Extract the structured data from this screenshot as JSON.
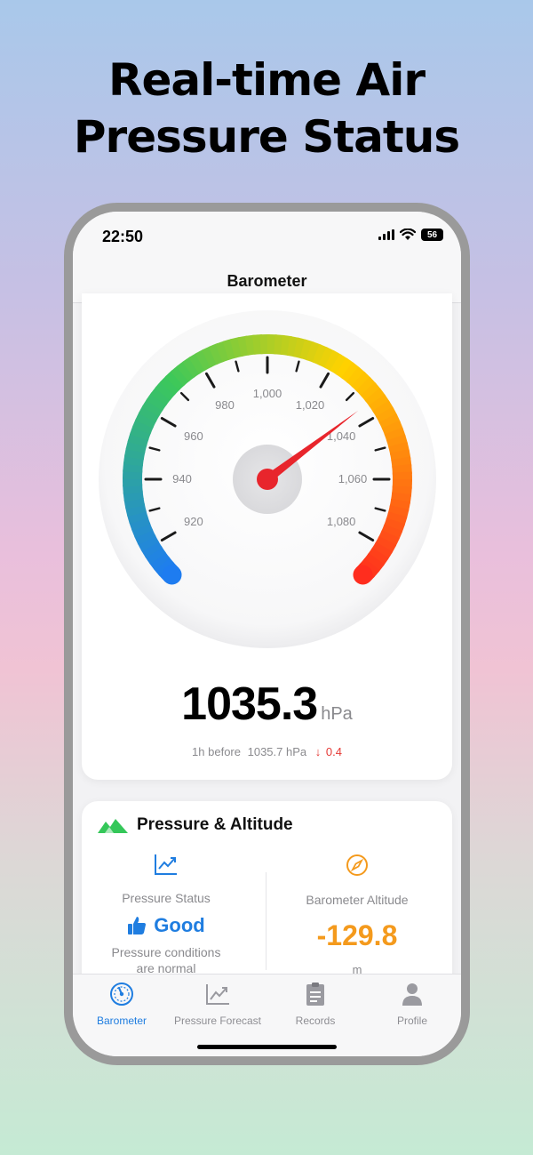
{
  "headline": {
    "line1": "Real-time Air",
    "line2": "Pressure Status"
  },
  "status_bar": {
    "time": "22:50",
    "battery": "56"
  },
  "nav": {
    "title": "Barometer"
  },
  "gauge": {
    "reading": "1035.3",
    "unit": "hPa",
    "min": 910,
    "max": 1090,
    "value": 1035.3,
    "tick_labels": [
      "920",
      "940",
      "960",
      "980",
      "1,000",
      "1,020",
      "1,040",
      "1,060",
      "1,080"
    ],
    "history_prefix": "1h before",
    "history_value": "1035.7 hPa",
    "history_change": "0.4",
    "colors": {
      "needle": "#e8252c",
      "arc_start": "#1e7cf0",
      "arc_mid": "#3cc85a",
      "arc_high": "#ffd200",
      "arc_end": "#ff2d1e"
    }
  },
  "altitude_card": {
    "title": "Pressure & Altitude",
    "header_icon": "mountain-icon",
    "left": {
      "icon": "trend-chart-icon",
      "label": "Pressure Status",
      "status_icon": "thumbs-up-icon",
      "status": "Good",
      "description_line1": "Pressure conditions",
      "description_line2": "are normal"
    },
    "right": {
      "icon": "compass-icon",
      "label": "Barometer Altitude",
      "value": "-129.8",
      "unit": "m"
    }
  },
  "tabs": [
    {
      "label": "Barometer",
      "icon": "gauge-icon",
      "active": true
    },
    {
      "label": "Pressure Forecast",
      "icon": "chart-icon",
      "active": false
    },
    {
      "label": "Records",
      "icon": "clipboard-icon",
      "active": false
    },
    {
      "label": "Profile",
      "icon": "person-icon",
      "active": false
    }
  ],
  "accent_color": "#1f7de0"
}
